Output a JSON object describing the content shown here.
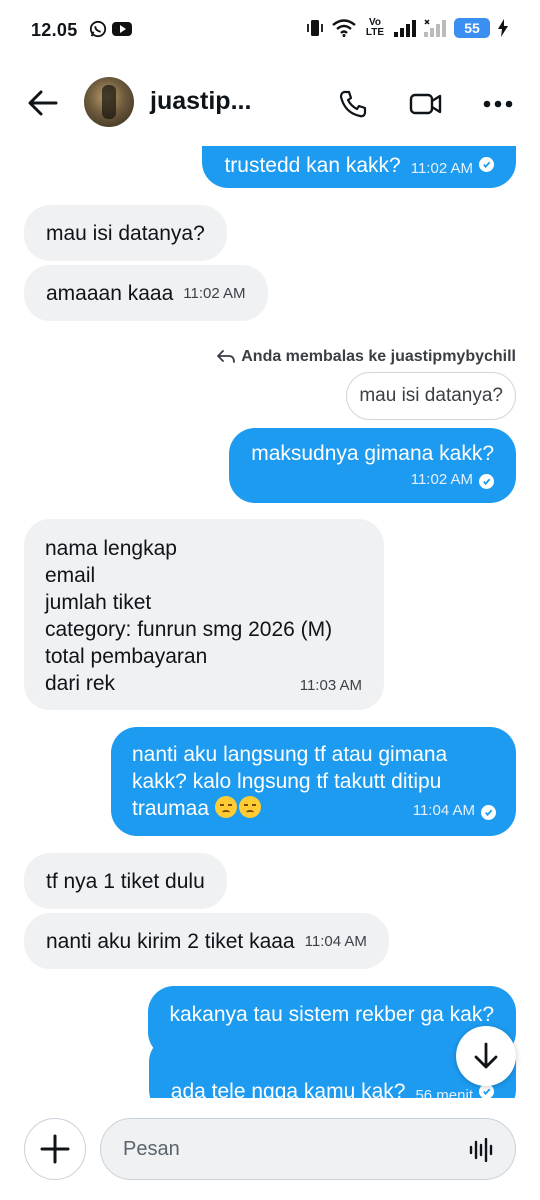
{
  "status_bar": {
    "time": "12.05",
    "network": "Vo LTE",
    "battery": "55"
  },
  "header": {
    "name": "juastip..."
  },
  "messages": [
    {
      "side": "sent",
      "text": "trustedd kan kakk?",
      "time": "11:02 AM"
    },
    {
      "side": "received",
      "text": "mau isi datanya?"
    },
    {
      "side": "received",
      "text": "amaaan kaaa",
      "time": "11:02 AM"
    },
    {
      "side": "sent",
      "reply_label": "Anda membalas ke juastipmybychill",
      "quote": "mau isi datanya?",
      "text": "maksudnya gimana kakk?",
      "time": "11:02 AM"
    },
    {
      "side": "received",
      "lines": [
        "nama lengkap",
        "email",
        "jumlah tiket",
        "category: funrun smg 2026 (M)",
        "total pembayaran",
        "dari rek"
      ],
      "time": "11:03 AM"
    },
    {
      "side": "sent",
      "lines": [
        "nanti aku langsung tf atau gimana",
        "kakk? kalo lngsung tf takutt ditipu",
        "traumaa"
      ],
      "emojis": [
        "pensive-face",
        "pensive-face"
      ],
      "time": "11:04 AM"
    },
    {
      "side": "received",
      "text": "tf nya 1 tiket dulu"
    },
    {
      "side": "received",
      "text": "nanti aku kirim 2 tiket kaaa",
      "time": "11:04 AM"
    },
    {
      "side": "sent",
      "text": "kakanya tau sistem rekber ga kak?"
    },
    {
      "side": "sent",
      "text": "ada tele ngga kamu kak?",
      "time": "56 menit"
    }
  ],
  "composer": {
    "placeholder": "Pesan"
  }
}
